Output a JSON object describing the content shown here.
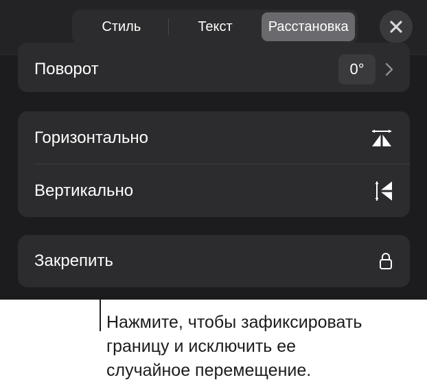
{
  "tabs": [
    {
      "label": "Стиль",
      "active": false
    },
    {
      "label": "Текст",
      "active": false
    },
    {
      "label": "Расстановка",
      "active": true
    }
  ],
  "rotation": {
    "label": "Поворот",
    "value": "0°"
  },
  "flip": {
    "horizontal_label": "Горизонтально",
    "vertical_label": "Вертикально"
  },
  "lock": {
    "label": "Закрепить"
  },
  "callout": {
    "lines": [
      "Нажмите, чтобы зафиксировать",
      "границу и исключить ее",
      "случайное перемещение."
    ]
  },
  "colors": {
    "panel_bg": "#1c1c1e",
    "group_bg": "#2c2c2e",
    "active_segment": "#6a6a6e",
    "text": "#ffffff"
  },
  "icons": {
    "close": "close-icon",
    "chevron": "chevron-right-icon",
    "flip_horizontal": "flip-horizontal-icon",
    "flip_vertical": "flip-vertical-icon",
    "lock": "lock-icon"
  }
}
